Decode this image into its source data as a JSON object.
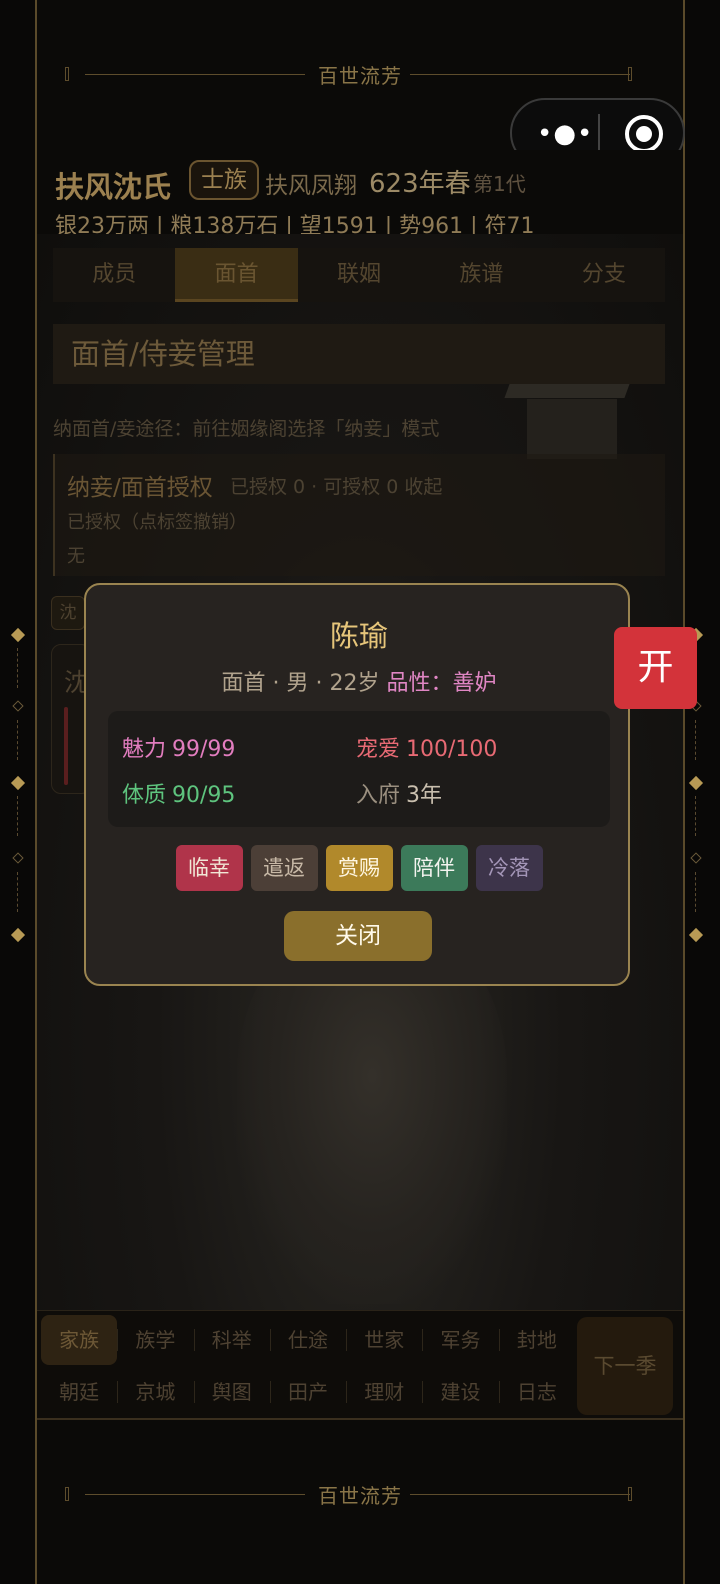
{
  "banner": {
    "title": "百世流芳"
  },
  "capsule": {
    "more_icon": "more-dots-icon",
    "close_icon": "target-icon"
  },
  "header": {
    "clan_name": "扶风沈氏",
    "clan_tag": "士族",
    "place": "扶风凤翔",
    "year": "623年春",
    "generation": "第1代",
    "resources": "银23万两 | 粮138万石 | 望1591 | 势961 | 符71"
  },
  "tabs": [
    "成员",
    "面首",
    "联姻",
    "族谱",
    "分支"
  ],
  "active_tab": "面首",
  "section": {
    "title": "面首/侍妾管理",
    "hint": "纳面首/妾途径：前往姻缘阁选择「纳妾」模式",
    "auth_title": "纳妾/面首授权",
    "auth_stats": "已授权 0 · 可授权 0  收起",
    "auth_sub": "已授权（点标签撤销）",
    "auth_none": "无",
    "chip": "沈",
    "card_initial": "沈"
  },
  "modal": {
    "name": "陈瑜",
    "info_prefix": "面首 · 男 · 22岁 ",
    "trait_label": "品性：善妒",
    "stats": {
      "charm_label": "魅力",
      "charm_value": "99/99",
      "favor_label": "宠爱",
      "favor_value": "100/100",
      "body_label": "体质",
      "body_value": "90/95",
      "years_label": "入府",
      "years_value": "3年"
    },
    "actions": [
      "临幸",
      "遣返",
      "赏赐",
      "陪伴",
      "冷落"
    ],
    "close_label": "关闭"
  },
  "open_button": "开",
  "bottom_nav": {
    "row1": [
      "家族",
      "族学",
      "科举",
      "仕途",
      "世家",
      "军务",
      "封地"
    ],
    "row2": [
      "朝廷",
      "京城",
      "舆图",
      "田产",
      "理财",
      "建设",
      "日志"
    ],
    "active": "家族",
    "next_season": "下一季"
  },
  "colors": {
    "gold": "#e6c57a",
    "accent_red": "#d3333a",
    "border_gold": "#9a8450"
  }
}
